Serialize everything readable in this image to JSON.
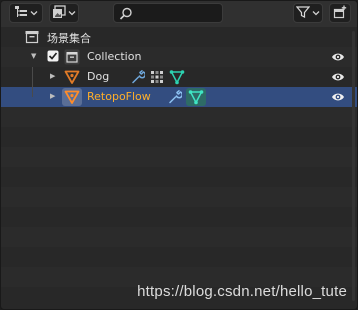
{
  "header": {
    "display_mode_icon": "outliner-view-icon",
    "filter_icon": "funnel-icon",
    "new_collection_icon": "new-collection-icon",
    "search": {
      "value": "",
      "placeholder": ""
    }
  },
  "tree": {
    "scene": {
      "label": "场景集合",
      "icon": "scene-collection-icon"
    },
    "items": [
      {
        "label": "Collection",
        "type": "collection",
        "checked": true,
        "visible": true
      },
      {
        "label": "Dog",
        "type": "mesh-object",
        "visible": true
      },
      {
        "label": "RetopoFlow",
        "type": "mesh-object",
        "visible": true,
        "selected": true
      }
    ]
  },
  "colors": {
    "selected_row": "#334d80",
    "active_label": "#ffaf29",
    "object_icon": "#e07a27",
    "wrench_icon": "#6fa8dc",
    "vertex_icon": "#2cd2b1"
  },
  "watermark": "https://blog.csdn.net/hello_tute"
}
